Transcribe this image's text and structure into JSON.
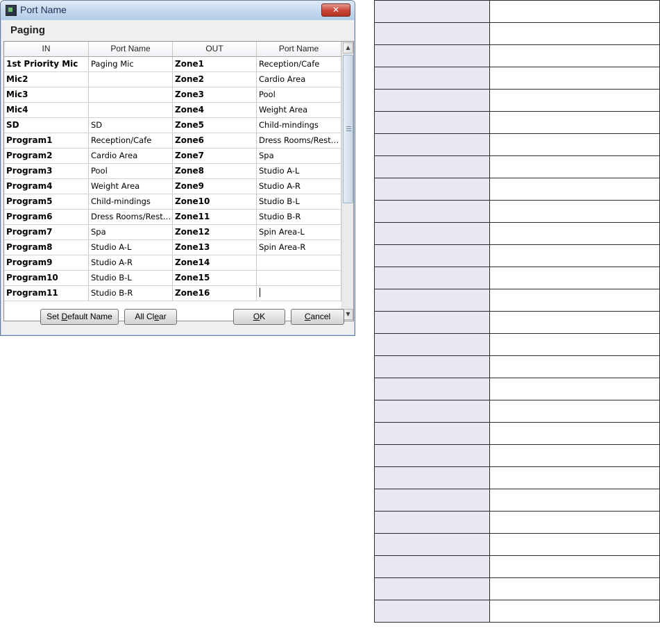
{
  "window": {
    "title": "Port Name",
    "close_label": "✕",
    "heading": "Paging"
  },
  "grid": {
    "headers": [
      "IN",
      "Port Name",
      "OUT",
      "Port Name"
    ],
    "rows": [
      {
        "in": "1st Priority Mic",
        "in_name": "Paging Mic",
        "out": "Zone1",
        "out_name": "Reception/Cafe"
      },
      {
        "in": "Mic2",
        "in_name": "",
        "out": "Zone2",
        "out_name": "Cardio Area"
      },
      {
        "in": "Mic3",
        "in_name": "",
        "out": "Zone3",
        "out_name": "Pool"
      },
      {
        "in": "Mic4",
        "in_name": "",
        "out": "Zone4",
        "out_name": "Weight Area"
      },
      {
        "in": "SD",
        "in_name": "SD",
        "out": "Zone5",
        "out_name": "Child-mindings"
      },
      {
        "in": "Program1",
        "in_name": "Reception/Cafe",
        "out": "Zone6",
        "out_name": "Dress Rooms/Rest ..."
      },
      {
        "in": "Program2",
        "in_name": "Cardio Area",
        "out": "Zone7",
        "out_name": "Spa"
      },
      {
        "in": "Program3",
        "in_name": "Pool",
        "out": "Zone8",
        "out_name": "Studio A-L"
      },
      {
        "in": "Program4",
        "in_name": "Weight Area",
        "out": "Zone9",
        "out_name": "Studio A-R"
      },
      {
        "in": "Program5",
        "in_name": "Child-mindings",
        "out": "Zone10",
        "out_name": "Studio B-L"
      },
      {
        "in": "Program6",
        "in_name": "Dress Rooms/Rest ...",
        "out": "Zone11",
        "out_name": "Studio B-R"
      },
      {
        "in": "Program7",
        "in_name": "Spa",
        "out": "Zone12",
        "out_name": "Spin Area-L"
      },
      {
        "in": "Program8",
        "in_name": "Studio A-L",
        "out": "Zone13",
        "out_name": "Spin Area-R"
      },
      {
        "in": "Program9",
        "in_name": "Studio A-R",
        "out": "Zone14",
        "out_name": ""
      },
      {
        "in": "Program10",
        "in_name": "Studio B-L",
        "out": "Zone15",
        "out_name": ""
      },
      {
        "in": "Program11",
        "in_name": "Studio B-R",
        "out": "Zone16",
        "out_name": ""
      }
    ],
    "scrollbar": {
      "up_icon": "▲",
      "down_icon": "▼"
    }
  },
  "buttons": {
    "set_default_pre": "Set ",
    "set_default_key": "D",
    "set_default_post": "efault Name",
    "all_clear_pre": "All Cl",
    "all_clear_key": "e",
    "all_clear_post": "ar",
    "ok_key": "O",
    "ok_post": "K",
    "cancel_key": "C",
    "cancel_post": "ancel"
  },
  "blank_table": {
    "rows": 28
  }
}
